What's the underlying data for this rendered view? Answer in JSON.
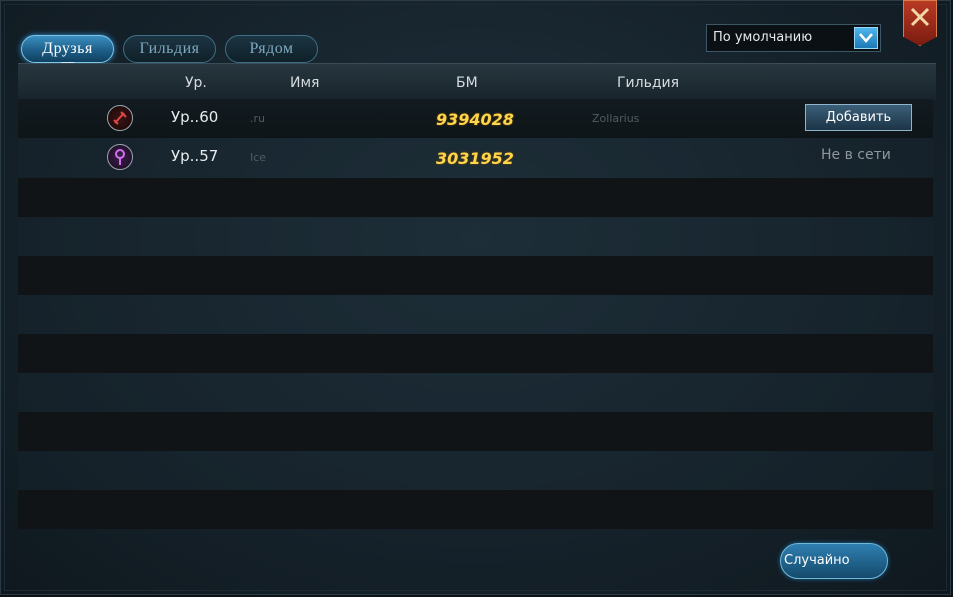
{
  "tabs": [
    {
      "label": "Друзья",
      "active": true
    },
    {
      "label": "Гильдия",
      "active": false
    },
    {
      "label": "Рядом",
      "active": false
    }
  ],
  "sort": {
    "selected": "По умолчанию"
  },
  "table": {
    "columns": [
      "Ур.",
      "Имя",
      "БМ",
      "Гильдия"
    ],
    "rows": [
      {
        "class_icon": "blade-class-icon",
        "class_color": "#c23a3a",
        "level": "Ур..60",
        "name": ".ru",
        "bm": "9394028",
        "guild": "Zollarius",
        "action": "Добавить"
      },
      {
        "class_icon": "staff-class-icon",
        "class_color": "#b04ccf",
        "level": "Ур..57",
        "name": "Ice",
        "bm": "3031952",
        "guild": "",
        "status": "Не в сети"
      }
    ]
  },
  "buttons": {
    "random": "Случайно"
  },
  "colors": {
    "accent": "#2f8fd0",
    "bm_gold": "#ffd64a",
    "close_red": "#b83a24"
  }
}
